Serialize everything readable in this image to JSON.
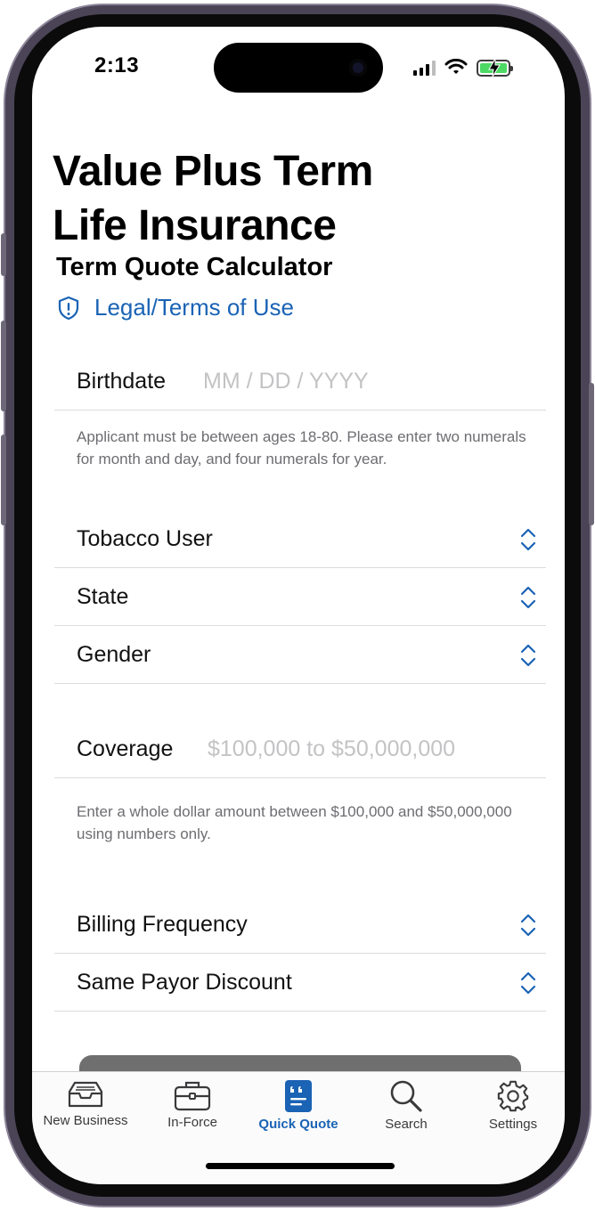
{
  "status_bar": {
    "time": "2:13"
  },
  "header": {
    "title_line1": "Value Plus Term",
    "title_line2": "Life Insurance",
    "subtitle": "Term Quote Calculator",
    "legal_link": "Legal/Terms of Use"
  },
  "form": {
    "birthdate": {
      "label": "Birthdate",
      "value": "",
      "placeholder": "MM / DD / YYYY",
      "helper": "Applicant must be between ages 18-80. Please enter two numerals for month and day, and four numerals for year."
    },
    "tobacco": {
      "label": "Tobacco User"
    },
    "state": {
      "label": "State"
    },
    "gender": {
      "label": "Gender"
    },
    "coverage": {
      "label": "Coverage",
      "value": "",
      "placeholder": "$100,000 to $50,000,000",
      "helper": "Enter a whole dollar amount between $100,000 and $50,000,000 using numbers only."
    },
    "billing": {
      "label": "Billing Frequency"
    },
    "same_payor": {
      "label": "Same Payor Discount"
    }
  },
  "tabbar": {
    "tabs": [
      {
        "label": "New Business",
        "icon": "inbox-tray-icon"
      },
      {
        "label": "In-Force",
        "icon": "briefcase-icon"
      },
      {
        "label": "Quick Quote",
        "icon": "quote-document-icon",
        "active": true
      },
      {
        "label": "Search",
        "icon": "magnifier-icon"
      },
      {
        "label": "Settings",
        "icon": "gear-icon"
      }
    ]
  },
  "colors": {
    "accent": "#1a63b5",
    "placeholder": "#c3c3c5",
    "helper_text": "#6d6d72",
    "battery": "#4cd964"
  }
}
